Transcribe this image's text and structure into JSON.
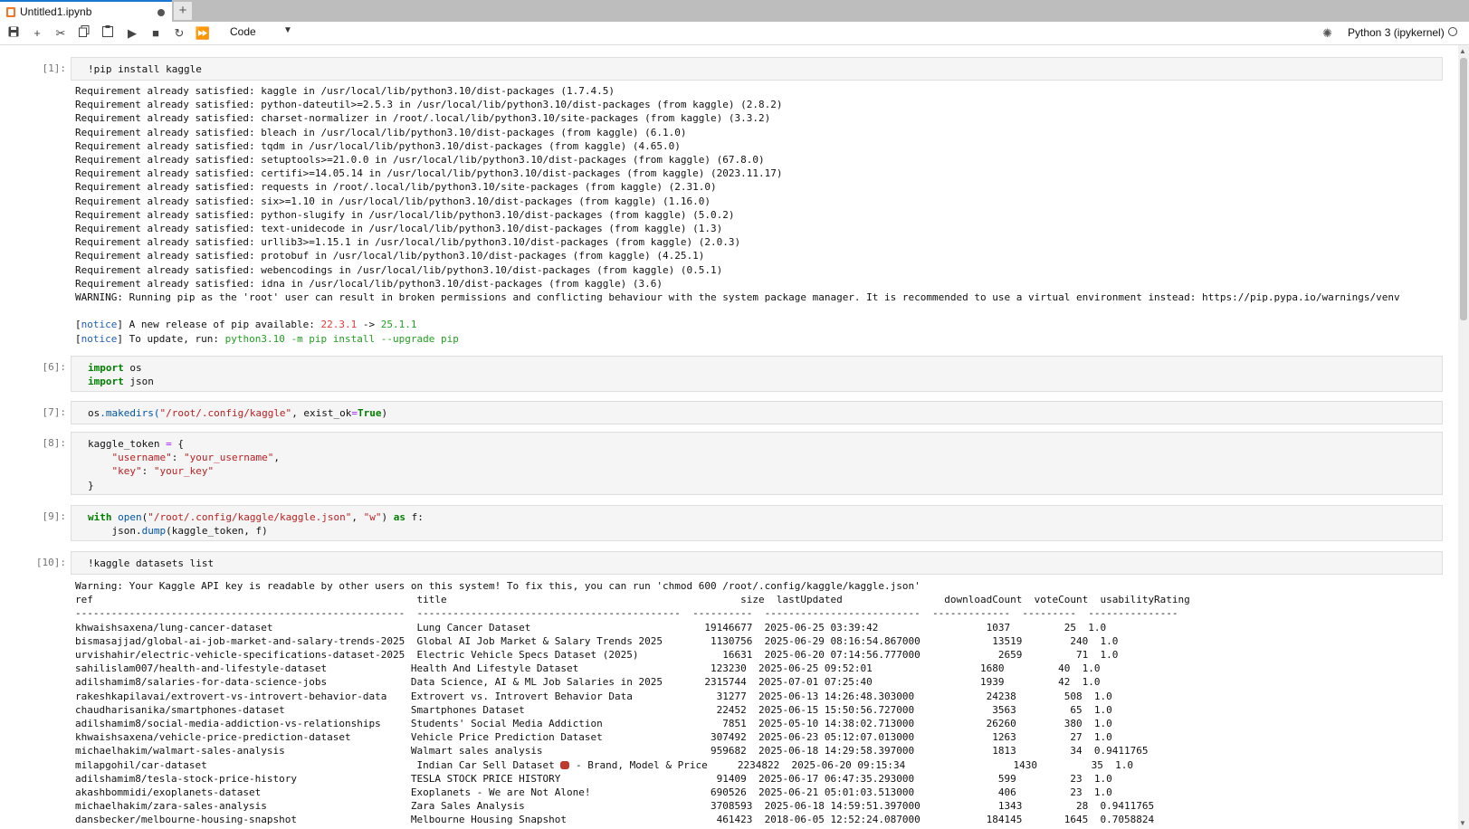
{
  "tab": {
    "title": "Untitled1.ipynb"
  },
  "toolbar": {
    "cell_type": "Code",
    "kernel": "Python 3 (ipykernel)"
  },
  "prompts": {
    "p1": "[1]:",
    "p6": "[6]:",
    "p7": "[7]:",
    "p8": "[8]:",
    "p9": "[9]:",
    "p10": "[10]:"
  },
  "cells": {
    "c1": "!pip install kaggle",
    "c6a": "os",
    "c6b": "json",
    "c7": {
      "open": ".makedirs(",
      "path": "\"/root/.config/kaggle\"",
      "arg": ", exist_ok",
      "val": "True",
      "close": ")"
    },
    "c8": {
      "line1": "kaggle_token ",
      "key1": "\"username\"",
      "val1": "\"your_username\"",
      "key2": "\"key\"",
      "val2": "\"your_key\""
    },
    "c9": {
      "fn": "open",
      "path": "\"/root/.config/kaggle/kaggle.json\"",
      "mode": "\"w\"",
      "var": " f:",
      "line2a": "    json.",
      "line2b": "dump",
      "line2c": "(kaggle_token, f)"
    },
    "c10": "!kaggle datasets list"
  },
  "out1": {
    "lines": [
      "Requirement already satisfied: kaggle in /usr/local/lib/python3.10/dist-packages (1.7.4.5)",
      "Requirement already satisfied: python-dateutil>=2.5.3 in /usr/local/lib/python3.10/dist-packages (from kaggle) (2.8.2)",
      "Requirement already satisfied: charset-normalizer in /root/.local/lib/python3.10/site-packages (from kaggle) (3.3.2)",
      "Requirement already satisfied: bleach in /usr/local/lib/python3.10/dist-packages (from kaggle) (6.1.0)",
      "Requirement already satisfied: tqdm in /usr/local/lib/python3.10/dist-packages (from kaggle) (4.65.0)",
      "Requirement already satisfied: setuptools>=21.0.0 in /usr/local/lib/python3.10/dist-packages (from kaggle) (67.8.0)",
      "Requirement already satisfied: certifi>=14.05.14 in /usr/local/lib/python3.10/dist-packages (from kaggle) (2023.11.17)",
      "Requirement already satisfied: requests in /root/.local/lib/python3.10/site-packages (from kaggle) (2.31.0)",
      "Requirement already satisfied: six>=1.10 in /usr/local/lib/python3.10/dist-packages (from kaggle) (1.16.0)",
      "Requirement already satisfied: python-slugify in /usr/local/lib/python3.10/dist-packages (from kaggle) (5.0.2)",
      "Requirement already satisfied: text-unidecode in /usr/local/lib/python3.10/dist-packages (from kaggle) (1.3)",
      "Requirement already satisfied: urllib3>=1.15.1 in /usr/local/lib/python3.10/dist-packages (from kaggle) (2.0.3)",
      "Requirement already satisfied: protobuf in /usr/local/lib/python3.10/dist-packages (from kaggle) (4.25.1)",
      "Requirement already satisfied: webencodings in /usr/local/lib/python3.10/dist-packages (from kaggle) (0.5.1)",
      "Requirement already satisfied: idna in /usr/local/lib/python3.10/dist-packages (from kaggle) (3.6)"
    ],
    "warning": "WARNING: Running pip as the 'root' user can result in broken permissions and conflicting behaviour with the system package manager. It is recommended to use a virtual environment instead: https://pip.pypa.io/warnings/venv",
    "notice1_tag": "notice",
    "notice1_text": " A new release of pip available: ",
    "notice1_old": "22.3.1",
    "notice1_arrow": " -> ",
    "notice1_new": "25.1.1",
    "notice2_tag": "notice",
    "notice2_text": " To update, run: ",
    "notice2_cmd": "python3.10 -m pip install --upgrade pip"
  },
  "out10": {
    "warning": "Warning: Your Kaggle API key is readable by other users on this system! To fix this, you can run 'chmod 600 /root/.config/kaggle/kaggle.json'",
    "header": "ref                                                      title                                                 size  lastUpdated                 downloadCount  voteCount  usabilityRating",
    "rule": "-------------------------------------------------------  --------------------------------------------  ----------  --------------------------  -------------  ---------  ---------------",
    "rows": [
      "khwaishsaxena/lung-cancer-dataset                        Lung Cancer Dataset                             19146677  2025-06-25 03:39:42                  1037         25  1.0",
      "bismasajjad/global-ai-job-market-and-salary-trends-2025  Global AI Job Market & Salary Trends 2025        1130756  2025-06-29 08:16:54.867000            13519        240  1.0",
      "urvishahir/electric-vehicle-specifications-dataset-2025  Electric Vehicle Specs Dataset (2025)              16631  2025-06-20 07:14:56.777000             2659         71  1.0",
      "sahilislam007/health-and-lifestyle-dataset              Health And Lifestyle Dataset                      123230  2025-06-25 09:52:01                  1680         40  1.0",
      "adilshamim8/salaries-for-data-science-jobs              Data Science, AI & ML Job Salaries in 2025       2315744  2025-07-01 07:25:40                  1939         42  1.0",
      "rakeshkapilavai/extrovert-vs-introvert-behavior-data    Extrovert vs. Introvert Behavior Data              31277  2025-06-13 14:26:48.303000            24238        508  1.0",
      "chaudharisanika/smartphones-dataset                     Smartphones Dataset                                22452  2025-06-15 15:50:56.727000             3563         65  1.0",
      "adilshamim8/social-media-addiction-vs-relationships     Students' Social Media Addiction                    7851  2025-05-10 14:38:02.713000            26260        380  1.0",
      "khwaishsaxena/vehicle-price-prediction-dataset          Vehicle Price Prediction Dataset                  307492  2025-06-23 05:12:07.013000             1263         27  1.0",
      "michaelhakim/walmart-sales-analysis                     Walmart sales analysis                            959682  2025-06-18 14:29:58.397000             1813         34  0.9411765",
      "__EMOJI__",
      "adilshamim8/tesla-stock-price-history                   TESLA STOCK PRICE HISTORY                          91409  2025-06-17 06:47:35.293000              599         23  1.0",
      "akashbommidi/exoplanets-dataset                         Exoplanets - We are Not Alone!                    690526  2025-06-21 05:01:03.513000              406         23  1.0",
      "michaelhakim/zara-sales-analysis                        Zara Sales Analysis                               3708593  2025-06-18 14:59:51.397000             1343         28  0.9411765",
      "dansbecker/melbourne-housing-snapshot                   Melbourne Housing Snapshot                         461423  2018-06-05 12:52:24.087000           184145       1645  0.7058824"
    ],
    "emoji_row_a": "milapgohil/car-dataset                                   Indian Car Sell Dataset ",
    "emoji_row_b": " - Brand, Model & Price     2234822  2025-06-20 09:15:34                  1430         35  1.0"
  }
}
